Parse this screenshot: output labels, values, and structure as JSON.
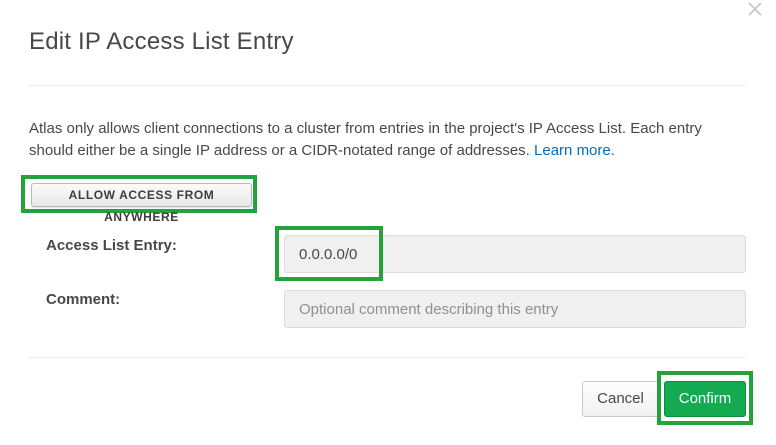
{
  "dialog": {
    "title": "Edit IP Access List Entry",
    "description": "Atlas only allows client connections to a cluster from entries in the project's IP Access List. Each entry should either be a single IP address or a CIDR-notated range of addresses.",
    "learn_more_label": "Learn more.",
    "allow_anywhere_label": "ALLOW ACCESS FROM ANYWHERE",
    "access_entry_label": "Access List Entry:",
    "access_entry_value": "0.0.0.0/0",
    "comment_label": "Comment:",
    "comment_placeholder": "Optional comment describing this entry",
    "cancel_label": "Cancel",
    "confirm_label": "Confirm"
  },
  "colors": {
    "highlight": "#24a23c",
    "confirm": "#13aa52",
    "link": "#006cbc"
  },
  "icons": {
    "close": "close-icon"
  }
}
